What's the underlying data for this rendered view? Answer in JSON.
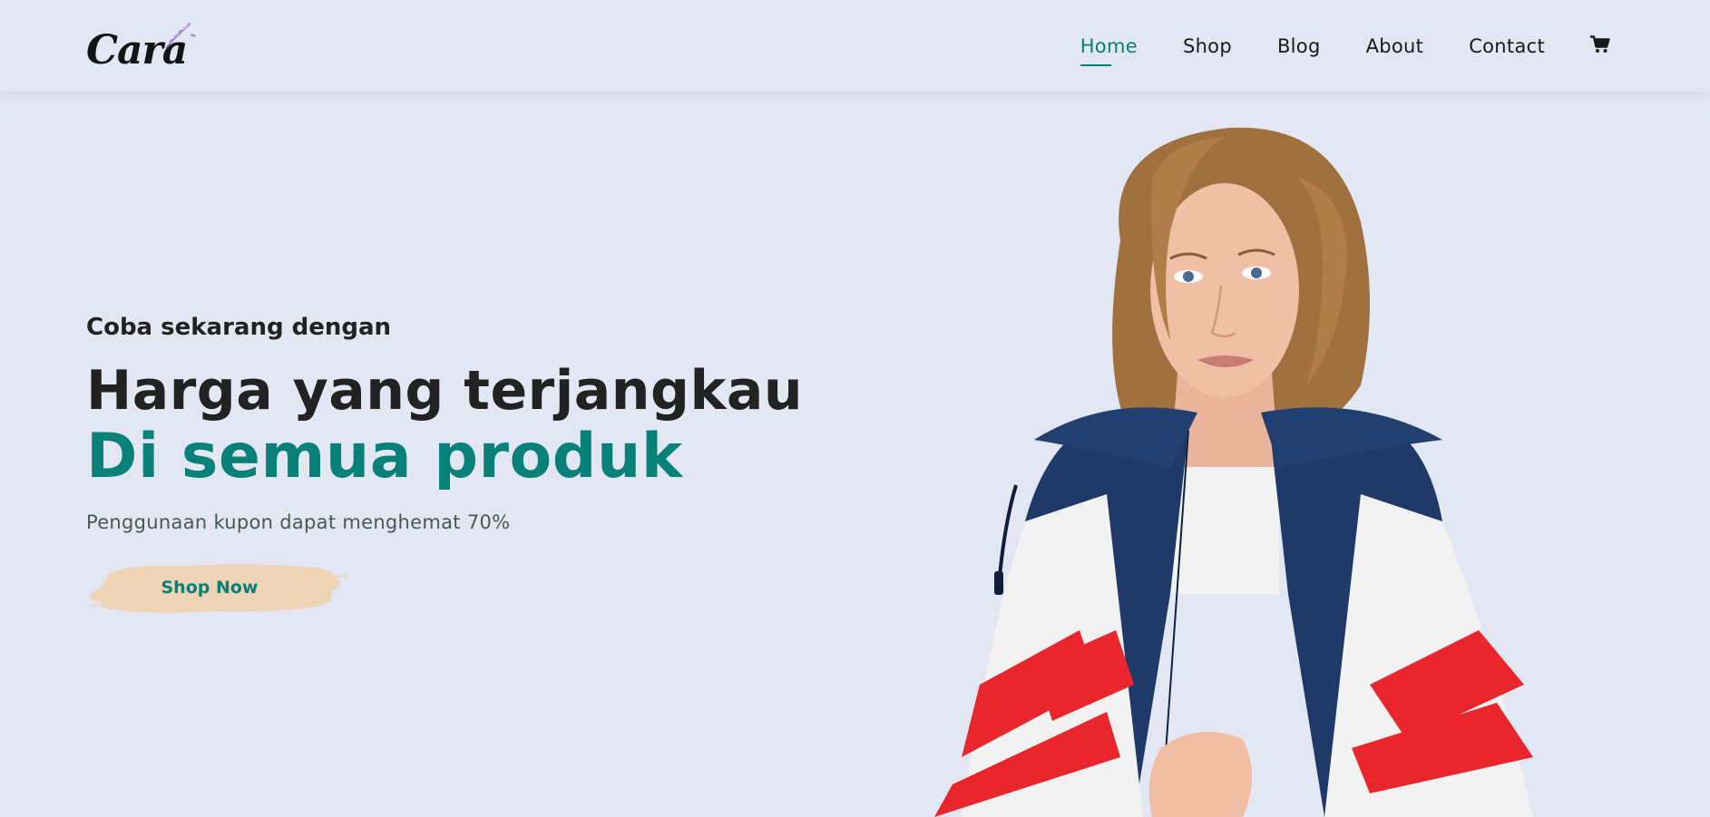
{
  "header": {
    "logo_text": "Cara",
    "nav": [
      {
        "label": "Home",
        "active": true
      },
      {
        "label": "Shop",
        "active": false
      },
      {
        "label": "Blog",
        "active": false
      },
      {
        "label": "About",
        "active": false
      },
      {
        "label": "Contact",
        "active": false
      }
    ],
    "cart_icon": "shopping-cart-icon"
  },
  "hero": {
    "pretitle": "Coba sekarang dengan",
    "headline": "Harga yang terjangkau",
    "highlight": "Di semua produk",
    "subtitle": "Penggunaan kupon dapat menghemat 70%",
    "cta_label": "Shop Now"
  },
  "colors": {
    "background": "#e3e6f3",
    "accent": "#088178",
    "button_brush": "#eed3b5",
    "text_dark": "#222222"
  }
}
